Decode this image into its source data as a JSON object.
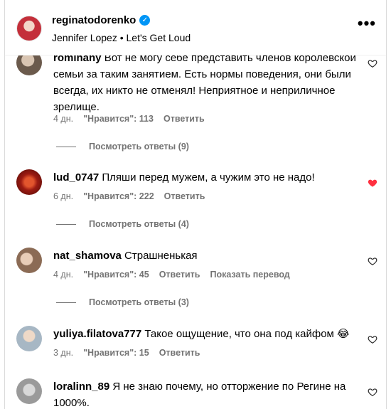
{
  "header": {
    "username": "reginatodorenko",
    "verified_mark": "✓",
    "audio": "Jennifer Lopez • Let's Get Loud",
    "more_label": "•••"
  },
  "labels": {
    "like": "\"Нравится\":",
    "reply": "Ответить",
    "translate": "Показать перевод"
  },
  "comments": [
    {
      "user": "rominany",
      "text": "Вот не могу себе представить членов королевской семьи за таким занятием. Есть нормы поведения, они были всегда, их никто не отменял! Неприятное и неприличное зрелище.",
      "age": "4 дн.",
      "likes": "113",
      "replies": "Посмотреть ответы (9)",
      "liked": false
    },
    {
      "user": "lud_0747",
      "text": "Пляши перед мужем, а чужим это не надо!",
      "age": "6 дн.",
      "likes": "222",
      "replies": "Посмотреть ответы (4)",
      "liked": true
    },
    {
      "user": "nat_shamova",
      "text": "Страшненькая",
      "age": "4 дн.",
      "likes": "45",
      "replies": "Посмотреть ответы (3)",
      "liked": false,
      "translate": true
    },
    {
      "user": "yuliya.filatova777",
      "text": "Такое ощущение, что она под кайфом 😂",
      "age": "3 дн.",
      "likes": "15",
      "liked": false
    },
    {
      "user": "loralinn_89",
      "text": "Я не знаю почему, но отторжение по Регине на 1000%.",
      "liked": false
    }
  ],
  "colors": {
    "like_red": "#ff3040",
    "meta_gray": "#737373",
    "verified_blue": "#0095f6"
  }
}
